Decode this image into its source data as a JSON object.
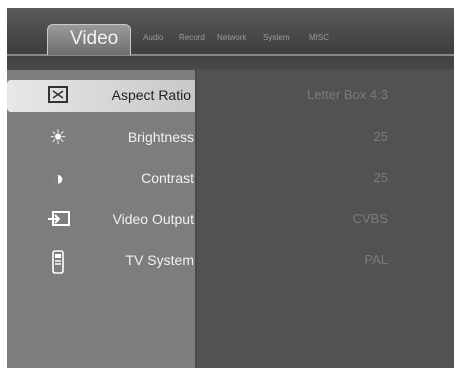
{
  "header": {
    "current_tab": "Video",
    "tabs": [
      "Audio",
      "Record",
      "Network",
      "System",
      "MISC"
    ]
  },
  "settings": [
    {
      "label": "Aspect Ratio",
      "value": "Letter Box 4:3",
      "icon": "aspect-ratio-icon"
    },
    {
      "label": "Brightness",
      "value": "25",
      "icon": "sun-icon"
    },
    {
      "label": "Contrast",
      "value": "25",
      "icon": "contrast-icon"
    },
    {
      "label": "Video Output",
      "value": "CVBS",
      "icon": "video-output-icon"
    },
    {
      "label": "TV System",
      "value": "PAL",
      "icon": "remote-icon"
    }
  ]
}
